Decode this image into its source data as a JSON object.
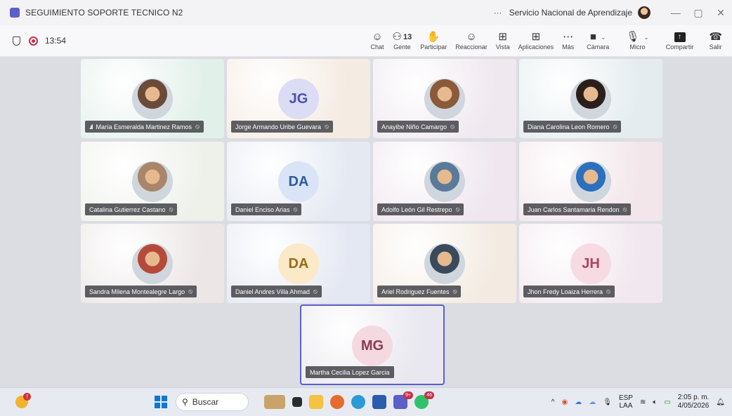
{
  "window": {
    "title": "SEGUIMIENTO SOPORTE TECNICO N2",
    "more": "···",
    "org": "Servicio Nacional de Aprendizaje",
    "minimize": "—",
    "maximize": "▢",
    "close": "✕"
  },
  "toolbar": {
    "timer": "13:54",
    "chat": "Chat",
    "people": "Gente",
    "people_count": "13",
    "raise": "Participar",
    "react": "Reaccionar",
    "view": "Vista",
    "apps": "Aplicaciones",
    "more": "Más",
    "camera": "Cámara",
    "mic": "Micro",
    "share": "Compartir",
    "leave": "Salir"
  },
  "participants": [
    {
      "name": "María Esmeralda Martinez Ramos",
      "avatar": "photo",
      "bg": "#e2f0ea",
      "ring": "#6b4a3a"
    },
    {
      "name": "Jorge Armando Uribe Guevara",
      "avatar": "JG",
      "bg": "#f4ebe2",
      "fill": "#dcdcf4",
      "color": "#4b53a8"
    },
    {
      "name": "Anayibe Niño Camargo",
      "avatar": "photo",
      "bg": "#efe8ef",
      "ring": "#8a5a3a"
    },
    {
      "name": "Diana Carolina Leon Romero",
      "avatar": "photo",
      "bg": "#e4ecef",
      "ring": "#2b1f1c"
    },
    {
      "name": "Catalina Gutierrez Castano",
      "avatar": "photo",
      "bg": "#eef1ea",
      "ring": "#a9866a"
    },
    {
      "name": "Daniel Enciso Arias",
      "avatar": "DA",
      "bg": "#e4e9f2",
      "fill": "#d9e4f6",
      "color": "#2f5c9a"
    },
    {
      "name": "Adolfo León Gil Restrepo",
      "avatar": "photo",
      "bg": "#efe6ef",
      "ring": "#5a7a9a"
    },
    {
      "name": "Juan Carlos Santamaria Rendon",
      "avatar": "photo",
      "bg": "#f2e6ea",
      "ring": "#2b6fbf"
    },
    {
      "name": "Sandra Milena Montealegre Largo",
      "avatar": "photo",
      "bg": "#ece6e6",
      "ring": "#b64a3a"
    },
    {
      "name": "Daniel Andres Villa Ahmad",
      "avatar": "DA",
      "bg": "#e4e8f2",
      "fill": "#fbe9c8",
      "color": "#9a6b17"
    },
    {
      "name": "Ariel Rodriguez Fuentes",
      "avatar": "photo",
      "bg": "#f3ebe2",
      "ring": "#3a4a5a"
    },
    {
      "name": "Jhon Fredy Loaiza Herrera",
      "avatar": "JH",
      "bg": "#f1e7ee",
      "fill": "#f7dbe3",
      "color": "#b04066"
    }
  ],
  "self_tile": {
    "name": "Martha Cecilia Lopez Garcia",
    "avatar": "MG",
    "bg": "#e9e7ef",
    "fill": "#f5d9e1",
    "color": "#8c3a55",
    "border": "#5b5fc7"
  },
  "taskbar": {
    "search_placeholder": "Buscar",
    "badge_teams": "9+",
    "badge_whatsapp": "46",
    "language_1": "ESP",
    "language_2": "LAA",
    "time": "2:05 p. m.",
    "date": "4/05/2026"
  }
}
